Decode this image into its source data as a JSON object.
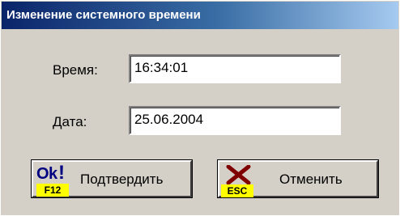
{
  "window": {
    "title": "Изменение системного времени"
  },
  "form": {
    "time_label": "Время:",
    "time_value": "16:34:01",
    "date_label": "Дата:",
    "date_value": "25.06.2004"
  },
  "buttons": {
    "confirm": {
      "icon_text": "Ok",
      "key": "F12",
      "label": "Подтвердить"
    },
    "cancel": {
      "key": "ESC",
      "label": "Отменить"
    }
  },
  "colors": {
    "title_gradient_start": "#0a246a",
    "title_gradient_end": "#a6caf0",
    "face": "#d4d0c8",
    "key_badge": "#ffff00",
    "x_icon": "#800000"
  }
}
